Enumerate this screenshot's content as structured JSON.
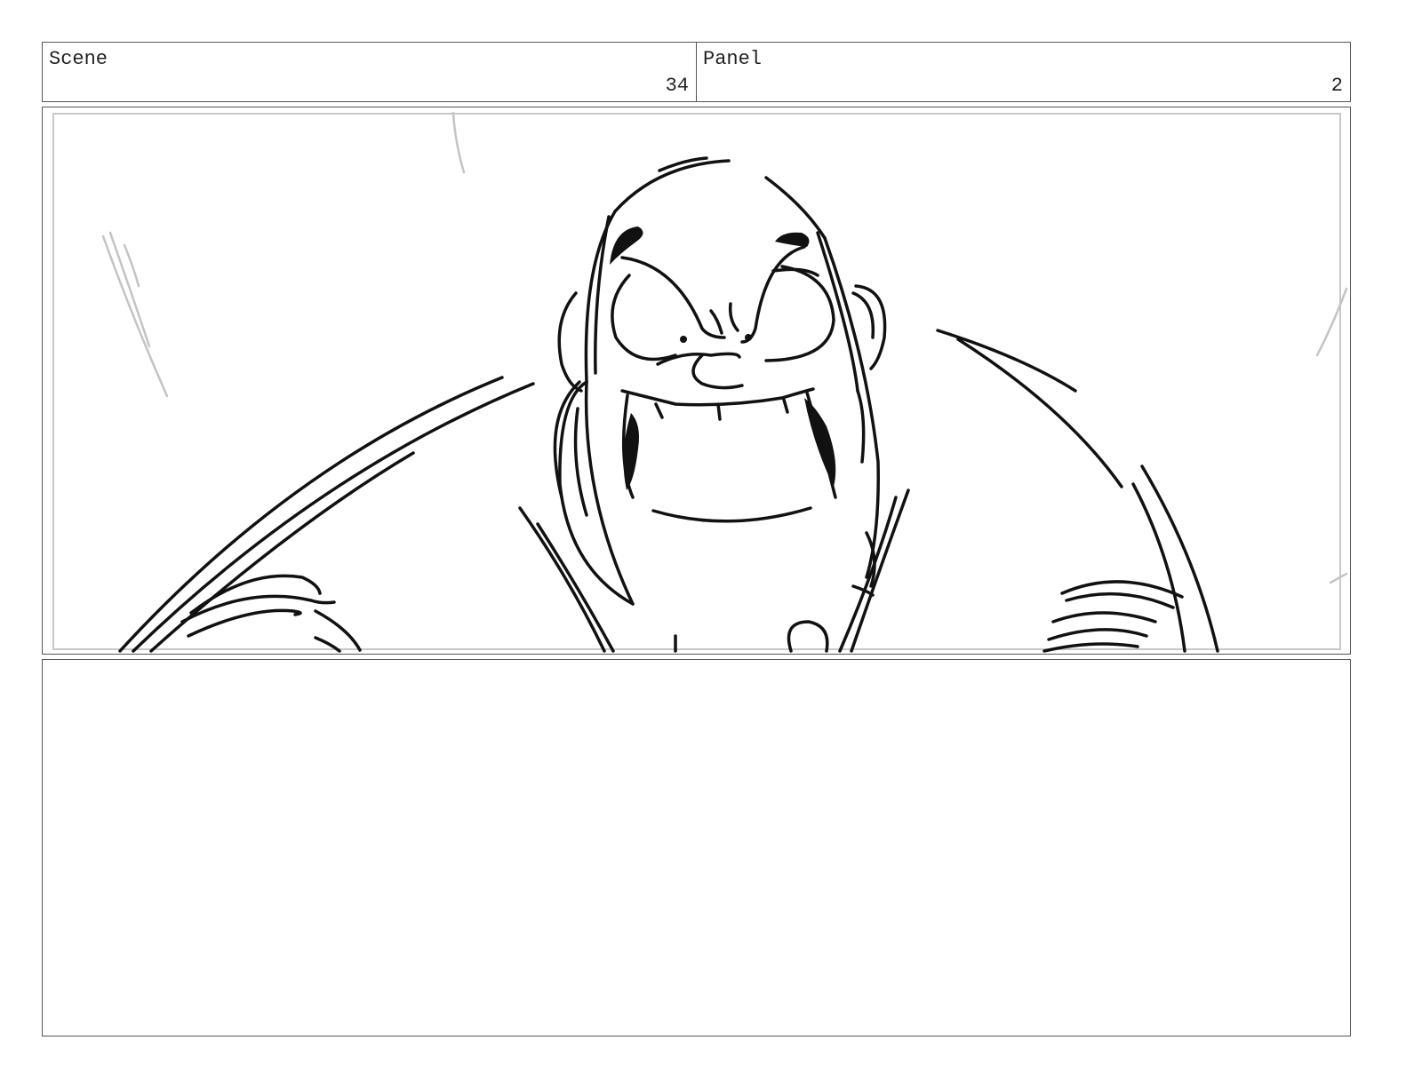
{
  "header": {
    "scene_label": "Scene",
    "scene_number": "34",
    "panel_label": "Panel",
    "panel_number": "2"
  }
}
